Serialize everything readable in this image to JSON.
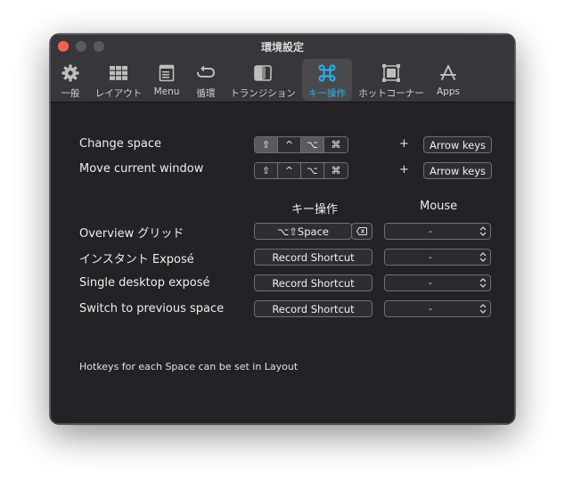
{
  "window": {
    "title": "環境設定"
  },
  "toolbar": {
    "items": [
      {
        "label": "一般",
        "icon": "gear-icon"
      },
      {
        "label": "レイアウト",
        "icon": "grid-icon"
      },
      {
        "label": "Menu",
        "icon": "menu-icon"
      },
      {
        "label": "循環",
        "icon": "cycle-icon"
      },
      {
        "label": "トランジション",
        "icon": "transition-icon"
      },
      {
        "label": "キー操作",
        "icon": "command-key-icon",
        "active": true
      },
      {
        "label": "ホットコーナー",
        "icon": "hot-corner-icon"
      },
      {
        "label": "Apps",
        "icon": "apps-icon"
      }
    ],
    "accent": "#29b2f0"
  },
  "shortcuts": {
    "change_space": {
      "label": "Change space",
      "modifiers": [
        "⇧",
        "^",
        "⌥",
        "⌘"
      ],
      "active_modifiers": [
        0,
        2
      ],
      "plus": "+",
      "key_button": "Arrow keys"
    },
    "move_window": {
      "label": "Move current window",
      "modifiers": [
        "⇧",
        "^",
        "⌥",
        "⌘"
      ],
      "active_modifiers": [],
      "plus": "+",
      "key_button": "Arrow keys"
    }
  },
  "columns": {
    "keyboard": "キー操作",
    "mouse": "Mouse"
  },
  "rows": [
    {
      "label": "Overview グリッド",
      "shortcut": "⌥⇧Space",
      "mouse": "-"
    },
    {
      "label": "インスタント Exposé",
      "shortcut": "Record Shortcut",
      "mouse": "-"
    },
    {
      "label": "Single desktop exposé",
      "shortcut": "Record Shortcut",
      "mouse": "-"
    },
    {
      "label": "Switch to previous space",
      "shortcut": "Record Shortcut",
      "mouse": "-"
    }
  ],
  "footer": {
    "note": "Hotkeys for each Space can be set in Layout"
  }
}
